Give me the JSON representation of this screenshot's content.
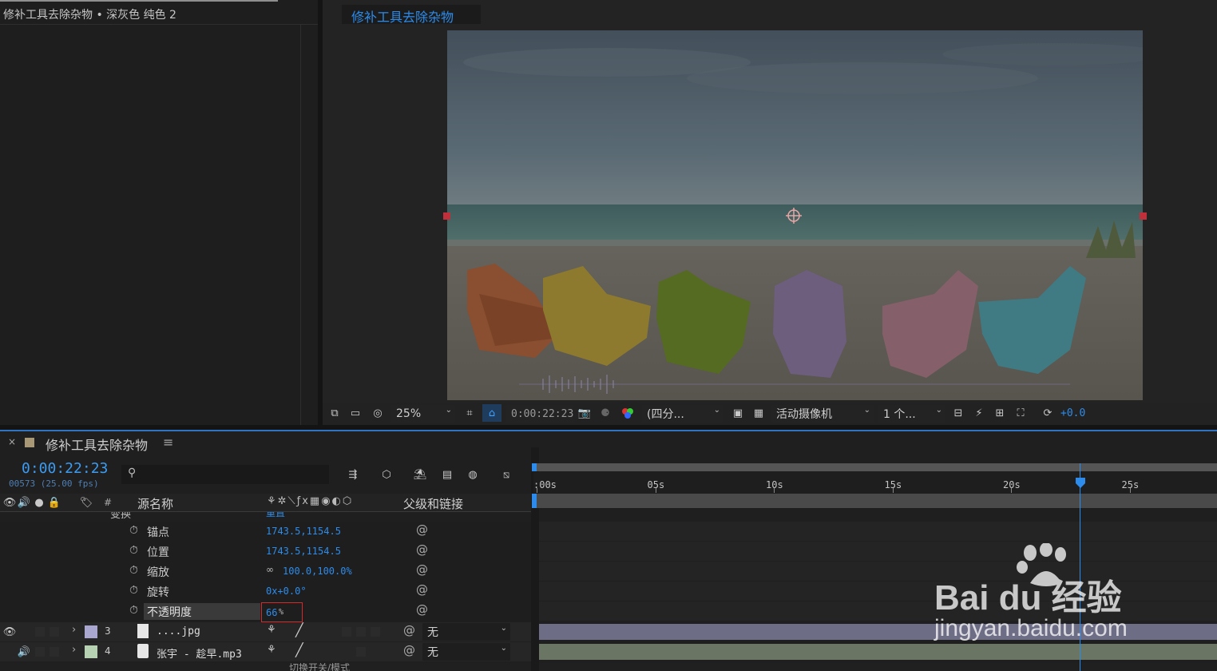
{
  "project_panel": {
    "title": "修补工具去除杂物 • 深灰色 纯色 2"
  },
  "viewer": {
    "tab_label": "修补工具去除杂物",
    "toolbar": {
      "zoom": "25%",
      "timecode": "0:00:22:23",
      "resolution": "(四分...",
      "camera": "活动摄像机",
      "views": "1 个...",
      "exposure": "+0.0"
    }
  },
  "timeline": {
    "comp_name": "修补工具去除杂物",
    "current_time": "0:00:22:23",
    "frame_info": "00573 (25.00 fps)",
    "search_placeholder": "",
    "columns": {
      "hash": "#",
      "source_name": "源名称",
      "parent_link": "父级和链接"
    },
    "ruler_labels": [
      ":00s",
      "05s",
      "10s",
      "15s",
      "20s",
      "25s"
    ],
    "playhead_seconds": 22.92,
    "transform_group": {
      "label": "变换",
      "reset": "重置"
    },
    "properties": [
      {
        "label": "锚点",
        "value": "1743.5,1154.5"
      },
      {
        "label": "位置",
        "value": "1743.5,1154.5"
      },
      {
        "label": "缩放",
        "value": "100.0,100.0%"
      },
      {
        "label": "旋转",
        "value": "0x+0.0°"
      },
      {
        "label": "不透明度",
        "value": "66",
        "unit": "%"
      }
    ],
    "layers": [
      {
        "num": "3",
        "name": "....jpg",
        "parent": "无",
        "label_color": "#a9a7cf",
        "track_color": "#6e6d86"
      },
      {
        "num": "4",
        "name": "张宇 - 趁早.mp3",
        "parent": "无",
        "label_color": "#b7d2b3",
        "track_color": "#6a7564"
      }
    ],
    "bottom_toggle": "切换开关/模式"
  },
  "watermark": {
    "brand": "Bai du 经验",
    "url": "jingyan.baidu.com"
  },
  "colors": {
    "accent": "#2d8ceb",
    "panel_bg": "#1d1d1d",
    "highlight_box": "#d32b2b"
  }
}
